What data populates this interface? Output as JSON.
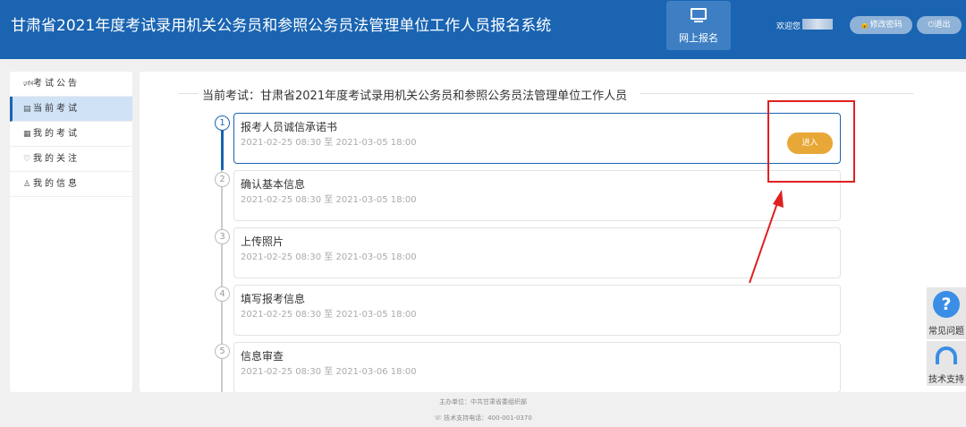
{
  "header": {
    "title": "甘肃省2021年度考试录用机关公务员和参照公务员法管理单位工作人员报名系统",
    "nav_label": "网上报名",
    "welcome": "欢迎您",
    "change_password": "🔒修改密码",
    "logout": "⏻退出"
  },
  "sidebar": {
    "items": [
      {
        "icon": "🕬",
        "label": "考试公告",
        "icon_name": "announcement-icon"
      },
      {
        "icon": "▤",
        "label": "当前考试",
        "icon_name": "exam-icon"
      },
      {
        "icon": "▦",
        "label": "我的考试",
        "icon_name": "my-exam-icon"
      },
      {
        "icon": "♡",
        "label": "我的关注",
        "icon_name": "heart-icon"
      },
      {
        "icon": "♙",
        "label": "我的信息",
        "icon_name": "user-icon"
      }
    ],
    "active_index": 1
  },
  "main": {
    "section_title": "当前考试：甘肃省2021年度考试录用机关公务员和参照公务员法管理单位工作人员",
    "steps": [
      {
        "num": "1",
        "title": "报考人员诚信承诺书",
        "date": "2021-02-25 08:30 至 2021-03-05 18:00",
        "active": true
      },
      {
        "num": "2",
        "title": "确认基本信息",
        "date": "2021-02-25 08:30 至 2021-03-05 18:00",
        "active": false
      },
      {
        "num": "3",
        "title": "上传照片",
        "date": "2021-02-25 08:30 至 2021-03-05 18:00",
        "active": false
      },
      {
        "num": "4",
        "title": "填写报考信息",
        "date": "2021-02-25 08:30 至 2021-03-05 18:00",
        "active": false
      },
      {
        "num": "5",
        "title": "信息审查",
        "date": "2021-02-25 08:30 至 2021-03-06 18:00",
        "active": false
      }
    ],
    "enter_label": "进入"
  },
  "help": {
    "faq_icon": "?",
    "faq_label": "常见问题",
    "tech_label": "技术支持"
  },
  "footer": {
    "line1": "主办单位：中共甘肃省委组织部",
    "line2": "☏ 技术支持电话：400-001-0370"
  },
  "colors": {
    "header_bg": "#1a64b2",
    "enter_button": "#e8a838",
    "annotation_red": "#e02020"
  }
}
